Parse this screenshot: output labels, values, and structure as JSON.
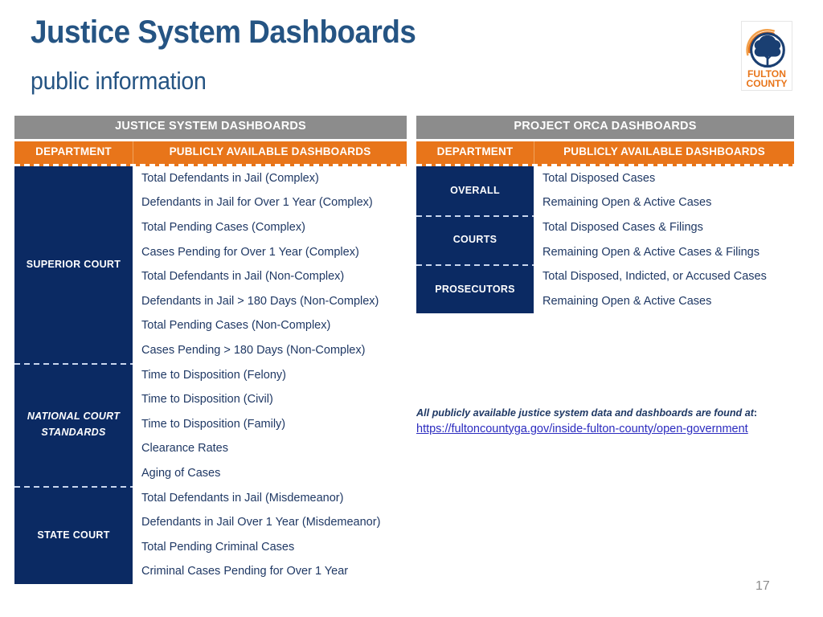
{
  "slide": {
    "title": "Justice System Dashboards",
    "subtitle": "public information",
    "page_number": "17"
  },
  "logo": {
    "name": "fulton-county-logo",
    "line1": "FULTON",
    "line2": "COUNTY",
    "tree_color": "#1a3f72",
    "ring_color": "#1a3f72",
    "swoosh_color": "#e8751a",
    "text_color": "#e8751a"
  },
  "colors": {
    "title_blue": "#255483",
    "header_gray": "#8c8c8c",
    "subhead_orange": "#e8751a",
    "dept_navy": "#0b2a63",
    "item_text": "#1f3864",
    "link_blue": "#2b2bbf",
    "page_number_gray": "#8c8c8c"
  },
  "tables": [
    {
      "id": "justice-system-dashboards",
      "title": "JUSTICE SYSTEM DASHBOARDS",
      "columns": [
        "DEPARTMENT",
        "PUBLICLY AVAILABLE DASHBOARDS"
      ],
      "groups": [
        {
          "department": "SUPERIOR COURT",
          "italic": false,
          "items": [
            "Total Defendants in Jail (Complex)",
            "Defendants in Jail for Over 1 Year (Complex)",
            "Total Pending Cases (Complex)",
            "Cases Pending for Over 1 Year (Complex)",
            "Total Defendants in Jail (Non-Complex)",
            "Defendants in Jail > 180 Days (Non-Complex)",
            "Total Pending Cases (Non-Complex)",
            "Cases Pending > 180 Days (Non-Complex)"
          ]
        },
        {
          "department": "NATIONAL COURT STANDARDS",
          "italic": true,
          "items": [
            "Time to Disposition (Felony)",
            "Time to Disposition (Civil)",
            "Time to Disposition (Family)",
            "Clearance Rates",
            "Aging of Cases"
          ]
        },
        {
          "department": "STATE COURT",
          "italic": false,
          "items": [
            "Total Defendants in Jail (Misdemeanor)",
            "Defendants in Jail Over 1 Year (Misdemeanor)",
            "Total Pending Criminal Cases",
            "Criminal Cases Pending for Over 1 Year"
          ]
        }
      ]
    },
    {
      "id": "project-orca-dashboards",
      "title": "PROJECT ORCA DASHBOARDS",
      "columns": [
        "DEPARTMENT",
        "PUBLICLY AVAILABLE DASHBOARDS"
      ],
      "groups": [
        {
          "department": "OVERALL",
          "italic": false,
          "items": [
            "Total Disposed Cases",
            "Remaining Open & Active Cases"
          ]
        },
        {
          "department": "COURTS",
          "italic": false,
          "items": [
            "Total Disposed Cases & Filings",
            "Remaining Open & Active Cases & Filings"
          ]
        },
        {
          "department": "PROSECUTORS",
          "italic": false,
          "items": [
            "Total Disposed, Indicted, or Accused Cases",
            "Remaining Open & Active Cases"
          ]
        }
      ]
    }
  ],
  "footnote": {
    "lead": "All publicly available justice system data and dashboards are found at",
    "colon": ":",
    "url": "https://fultoncountyga.gov/inside-fulton-county/open-government"
  }
}
